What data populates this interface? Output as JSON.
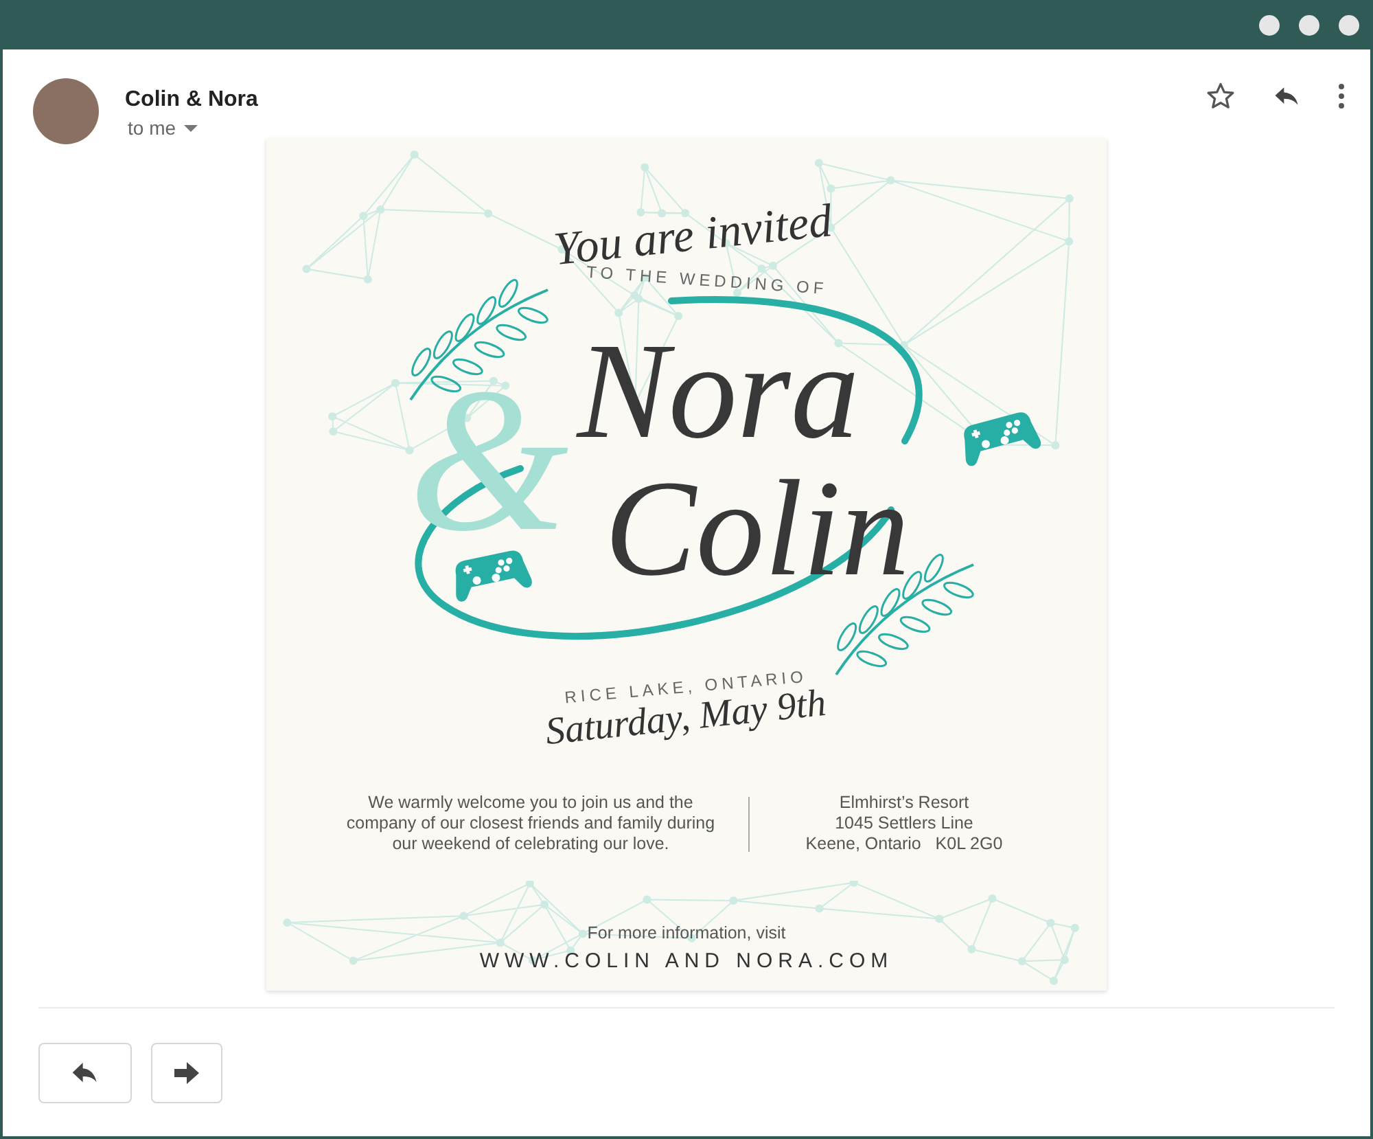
{
  "sender": {
    "name": "Colin & Nora",
    "recipient": "to me"
  },
  "invitation": {
    "heading": "You are invited",
    "subheading": "TO THE WEDDING OF",
    "first_name": "Nora",
    "ampersand": "&",
    "second_name": "Colin",
    "location": "RICE LAKE, ONTARIO",
    "date": "Saturday, May 9th",
    "message": "We warmly welcome you to join us and the company of our closest friends and family during our weekend of celebrating our love.",
    "venue": [
      "Elmhirst’s Resort",
      "1045 Settlers Line",
      "Keene, Ontario   K0L 2G0"
    ],
    "info": "For more information, visit",
    "website": "WWW.COLIN AND NORA.COM"
  }
}
